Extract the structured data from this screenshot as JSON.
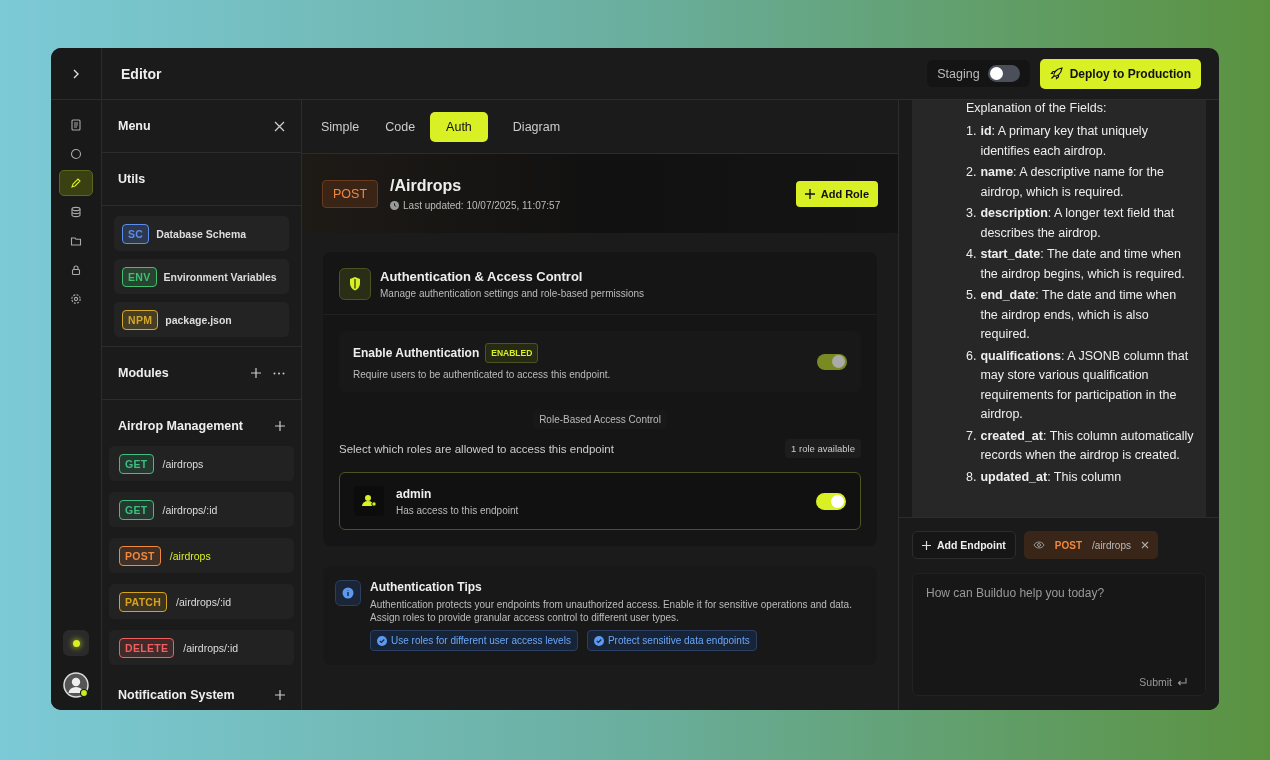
{
  "topbar": {
    "title": "Editor",
    "staging": {
      "label": "Staging",
      "on": false
    },
    "deploy_button": "Deploy to Production"
  },
  "rail": [
    {
      "selected": false
    },
    {
      "selected": false
    },
    {
      "selected": true
    },
    {
      "selected": false
    },
    {
      "selected": false
    },
    {
      "selected": false
    },
    {
      "selected": false
    }
  ],
  "menu": {
    "title": "Menu",
    "utils_title": "Utils",
    "utils": [
      {
        "tag": "SC",
        "label": "Database Schema",
        "color": "#5b8def"
      },
      {
        "tag": "ENV",
        "label": "Environment Variables",
        "color": "#3fbf6f"
      },
      {
        "tag": "NPM",
        "label": "package.json",
        "color": "#d4a72c"
      }
    ],
    "modules_title": "Modules",
    "groups": [
      {
        "title": "Airdrop Management",
        "endpoints": [
          {
            "method": "GET",
            "path": "/airdrops",
            "color": "#3fbf7f",
            "selected": false
          },
          {
            "method": "GET",
            "path": "/airdrops/:id",
            "color": "#3fbf7f",
            "selected": false
          },
          {
            "method": "POST",
            "path": "/airdrops",
            "color": "#f0883e",
            "selected": true
          },
          {
            "method": "PATCH",
            "path": "/airdrops/:id",
            "color": "#d9a21b",
            "selected": false
          },
          {
            "method": "DELETE",
            "path": "/airdrops/:id",
            "color": "#f06060",
            "selected": false
          }
        ]
      },
      {
        "title": "Notification System"
      }
    ]
  },
  "tabs": [
    {
      "label": "Simple",
      "selected": false
    },
    {
      "label": "Code",
      "selected": false
    },
    {
      "label": "Auth",
      "selected": true
    },
    {
      "label": "Diagram",
      "selected": false
    }
  ],
  "endpoint": {
    "method": "POST",
    "path": "/Airdrops",
    "updated": "Last updated: 10/07/2025, 11:07:57",
    "add_button": "Add Role"
  },
  "auth": {
    "title": "Authentication & Access Control",
    "subtitle": "Manage authentication settings and role-based permissions",
    "enable": {
      "label": "Enable Authentication",
      "badge": "ENABLED",
      "description": "Require users to be authenticated to access this endpoint.",
      "on": true
    },
    "section_label": "Role-Based Access Control",
    "prompt": "Select which roles are allowed to access this endpoint",
    "count": "1 role available",
    "roles": [
      {
        "name": "admin",
        "description": "Has access to this endpoint",
        "on": true
      }
    ]
  },
  "tips": {
    "title": "Authentication Tips",
    "text": "Authentication protects your endpoints from unauthorized access. Enable it for sensitive operations and data. Assign roles to provide granular access control to different user types.",
    "chips": [
      "Use roles for different user access levels",
      "Protect sensitive data endpoints"
    ]
  },
  "chat": {
    "heading": "Explanation of the Fields:",
    "items": [
      {
        "number": "1.",
        "text": "**id**: A primary key that uniquely identifies each airdrop."
      },
      {
        "number": "2.",
        "text": "**name**: A descriptive name for the airdrop, which is required."
      },
      {
        "number": "3.",
        "text": "**description**: A longer text field that describes the airdrop."
      },
      {
        "number": "4.",
        "text": "**start_date**: The date and time when the airdrop begins, which is required."
      },
      {
        "number": "5.",
        "text": "**end_date**: The date and time when the airdrop ends, which is also required."
      },
      {
        "number": "6.",
        "text": "**qualifications**: A JSONB column that may store various qualification requirements for participation in the airdrop."
      },
      {
        "number": "7.",
        "text": "**created_at**: This column automatically records when the airdrop is created."
      },
      {
        "number": "8.",
        "text": "**updated_at**: This column"
      }
    ]
  },
  "composer": {
    "add_button": "Add Endpoint",
    "context": {
      "method": "POST",
      "path": "/airdrops"
    },
    "placeholder": "How can Builduo help you today?",
    "submit": "Submit"
  }
}
